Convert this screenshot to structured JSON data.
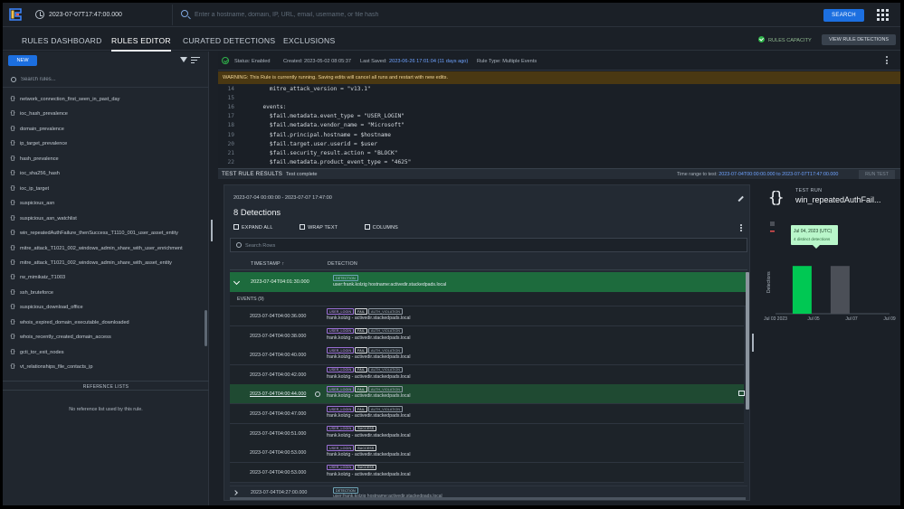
{
  "topbar": {
    "time_value": "2023-07-07T17:47:00.000",
    "search_placeholder": "Enter a hostname, domain, IP, URL, email, username, or file hash",
    "search_button": "SEARCH"
  },
  "nav": {
    "tabs": [
      "RULES DASHBOARD",
      "RULES EDITOR",
      "CURATED DETECTIONS",
      "EXCLUSIONS"
    ],
    "active_tab": "RULES EDITOR",
    "capacity_label": "RULES CAPACITY",
    "view_button": "VIEW RULE DETECTIONS"
  },
  "sidebar": {
    "new_button": "NEW",
    "search_placeholder": "Search rules...",
    "rules": [
      "network_connection_first_seen_in_past_day",
      "ioc_hash_prevalence",
      "domain_prevalence",
      "ip_target_prevalence",
      "hash_prevalence",
      "ioc_sha256_hash",
      "ioc_ip_target",
      "suspicious_asn",
      "suspicious_asn_watchlist",
      "win_repeatedAuthFailure_thenSuccess_T1110_001_user_asset_entity",
      "mitre_attack_T1021_002_windows_admin_share_with_user_enrichment",
      "mitre_attack_T1021_002_windows_admin_share_with_asset_entity",
      "rw_mimikatz_T1003",
      "ssh_bruteforce",
      "suspicious_download_office",
      "whois_expired_domain_executable_downloaded",
      "whois_recently_created_domain_access",
      "gcti_tor_exit_nodes",
      "vt_relationships_file_contacts_ip"
    ],
    "reference_header": "REFERENCE LISTS",
    "reference_empty": "No reference list used by this rule."
  },
  "editor": {
    "status": "Status: Enabled",
    "created": "Created: 2023-05-02 08:05:37",
    "last_saved_label": "Last Saved:",
    "last_saved_value": "2023-06-26 17:01:04 (11 days ago)",
    "rule_type": "Rule Type: Multiple Events",
    "warning": "WARNING: This Rule is currently running. Saving edits will cancel all runs and restart with new edits.",
    "code_lines": [
      {
        "n": "14",
        "t": "    mitre_attack_version = \"v13.1\""
      },
      {
        "n": "15",
        "t": ""
      },
      {
        "n": "16",
        "t": "  events:"
      },
      {
        "n": "17",
        "t": "    $fail.metadata.event_type = \"USER_LOGIN\""
      },
      {
        "n": "18",
        "t": "    $fail.metadata.vendor_name = \"Microsoft\""
      },
      {
        "n": "19",
        "t": "    $fail.principal.hostname = $hostname"
      },
      {
        "n": "20",
        "t": "    $fail.target.user.userid = $user"
      },
      {
        "n": "21",
        "t": "    $fail.security_result.action = \"BLOCK\""
      },
      {
        "n": "22",
        "t": "    $fail.metadata.product_event_type = \"4625\""
      }
    ]
  },
  "test": {
    "title": "TEST RULE RESULTS",
    "status": "Test complete",
    "range_label": "Time range to test:",
    "range_value": "2023-07-04T00:00:00.000 to 2023-07-07T17:47:00.000",
    "run_button": "RUN TEST"
  },
  "results": {
    "range": "2023-07-04 00:00:00 - 2023-07-07 17:47:00",
    "count": "8 Detections",
    "expand_all": "EXPAND ALL",
    "wrap_text": "WRAP TEXT",
    "columns": "COLUMNS",
    "search_placeholder": "Search Rows",
    "col_timestamp": "TIMESTAMP ↑",
    "col_detection": "DETECTION",
    "detection": {
      "timestamp": "2023-07-04T04:01:30.000",
      "badge": "DETECTION",
      "text": "user:frank.kolzig hostname:activedir.stackedpads.local"
    },
    "events_header": "EVENTS (9)",
    "events": [
      {
        "ts": "2023-07-04T04:00:36.000",
        "b1": "USER_LOGIN",
        "b2": "FAIL",
        "b3": "AUTH_VIOLATION",
        "text": "frank.kolzig - activedir.stackedpads.local"
      },
      {
        "ts": "2023-07-04T04:00:38.000",
        "b1": "USER_LOGIN",
        "b2": "FAIL",
        "b3": "AUTH_VIOLATION",
        "text": "frank.kolzig - activedir.stackedpads.local"
      },
      {
        "ts": "2023-07-04T04:00:40.000",
        "b1": "USER_LOGIN",
        "b2": "FAIL",
        "b3": "AUTH_VIOLATION",
        "text": "frank.kolzig - activedir.stackedpads.local"
      },
      {
        "ts": "2023-07-04T04:00:42.000",
        "b1": "USER_LOGIN",
        "b2": "FAIL",
        "b3": "AUTH_VIOLATION",
        "text": "frank.kolzig - activedir.stackedpads.local"
      },
      {
        "ts": "2023-07-04T04:00:44.000",
        "b1": "USER_LOGIN",
        "b2": "FAIL",
        "b3": "AUTH_VIOLATION",
        "text": "frank.kolzig - activedir.stackedpads.local"
      },
      {
        "ts": "2023-07-04T04:00:47.000",
        "b1": "USER_LOGIN",
        "b2": "FAIL",
        "b3": "AUTH_VIOLATION",
        "text": "frank.kolzig - activedir.stackedpads.local"
      },
      {
        "ts": "2023-07-04T04:00:51.000",
        "b1": "USER_LOGIN",
        "b2": "SUCCESS",
        "b3": "",
        "text": "frank.kolzig - activedir.stackedpads.local"
      },
      {
        "ts": "2023-07-04T04:00:53.000",
        "b1": "USER_LOGIN",
        "b2": "SUCCESS",
        "b3": "",
        "text": "frank.kolzig - activedir.stackedpads.local"
      },
      {
        "ts": "2023-07-04T04:00:53.000",
        "b1": "USER_LOGIN",
        "b2": "SUCCESS",
        "b3": "",
        "text": "frank.kolzig - activedir.stackedpads.local"
      }
    ],
    "selected_event_index": 4,
    "last_row": {
      "timestamp": "2023-07-04T04:27:00.000",
      "badge": "DETECTION",
      "text": "user:frank.kolzig hostname:activedir.stackedpads.local"
    }
  },
  "right_panel": {
    "label": "TEST RUN",
    "rule_name": "win_repeatedAuthFail..."
  },
  "chart_data": {
    "type": "bar",
    "categories": [
      "Jul 04",
      "Jul 06"
    ],
    "x_ticks": [
      "Jul 03 2023",
      "Jul 05",
      "Jul 07",
      "Jul 09"
    ],
    "values": [
      4,
      4
    ],
    "ylabel": "Detections",
    "tooltip_title": "Jul 04, 2023 (UTC)",
    "tooltip_text": "4 distinct detections",
    "colors": {
      "highlight": "#00c853",
      "default": "#4b4f57",
      "tooltip": "#b9f6ca"
    }
  },
  "colors": {
    "accent": "#1c6fe0",
    "detection_row": "#1d6b3d",
    "warning_bg": "#4a3812"
  }
}
